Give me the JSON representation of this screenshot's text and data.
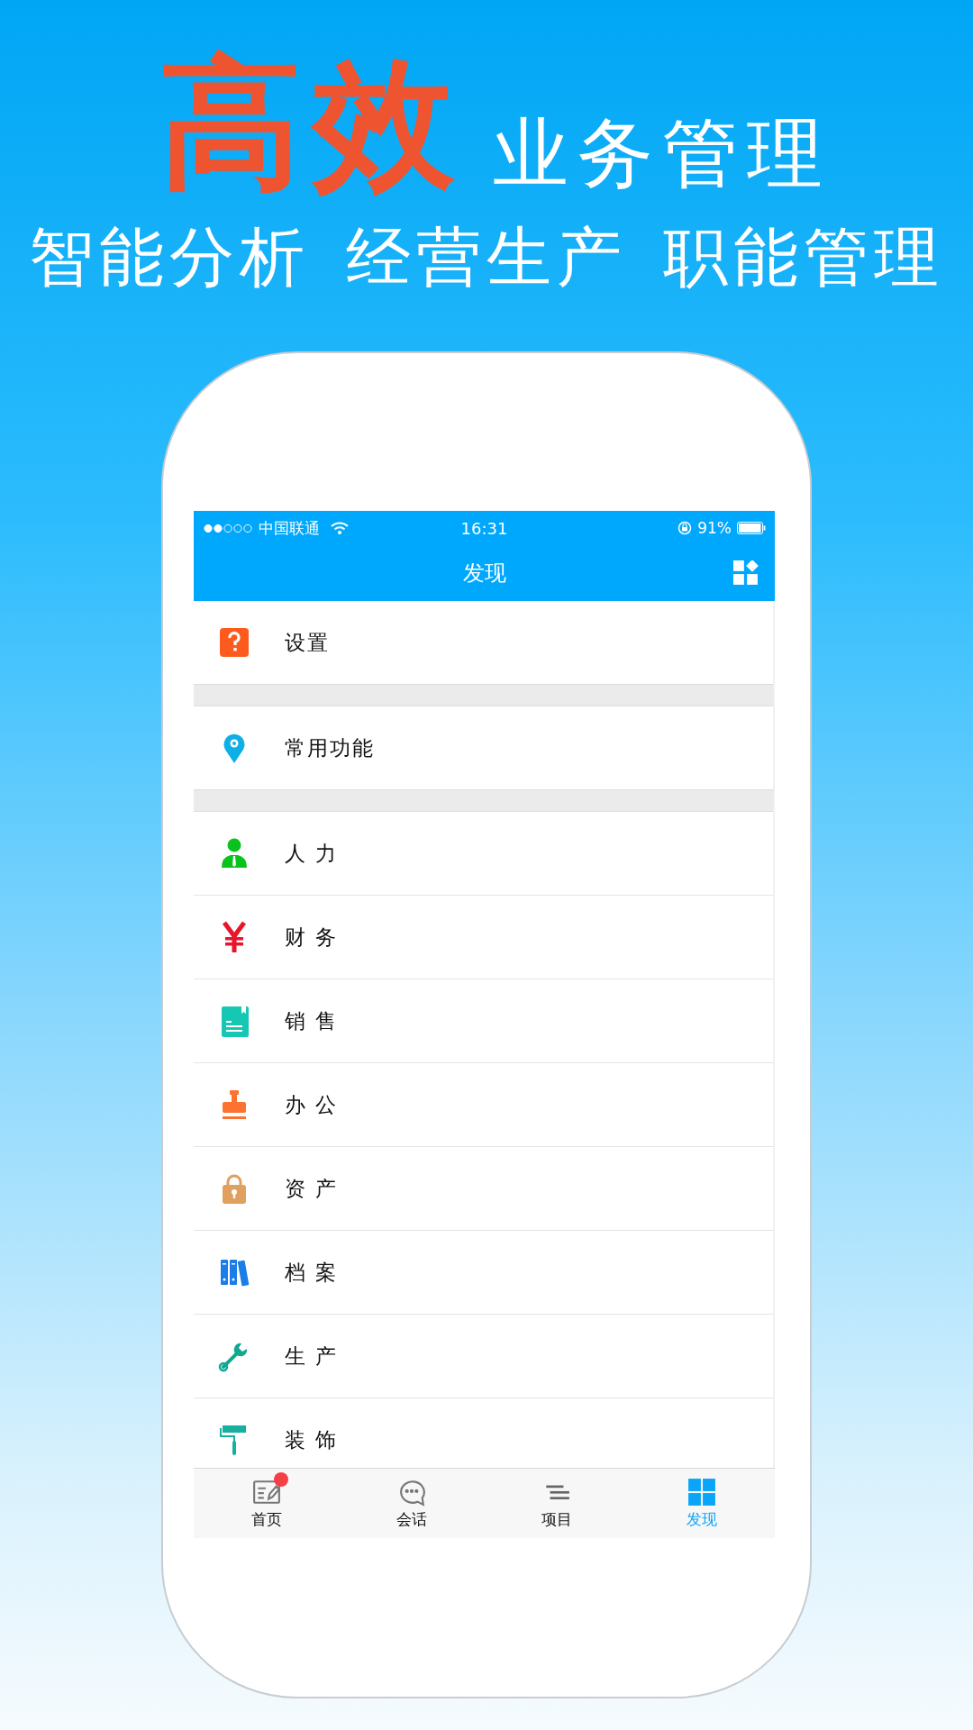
{
  "headline": {
    "emphasis": "高效",
    "rest": "业务管理"
  },
  "slogans": [
    "智能分析",
    "经营生产",
    "职能管理"
  ],
  "status_bar": {
    "carrier": "中国联通",
    "time": "16:31",
    "battery": "91%"
  },
  "nav_bar": {
    "title": "发现"
  },
  "sections": [
    [
      {
        "label": "设置"
      }
    ],
    [
      {
        "label": "常用功能"
      }
    ],
    [
      {
        "label": "人 力"
      },
      {
        "label": "财 务"
      },
      {
        "label": "销 售"
      },
      {
        "label": "办 公"
      },
      {
        "label": "资 产"
      },
      {
        "label": "档 案"
      },
      {
        "label": "生 产"
      },
      {
        "label": "装 饰"
      }
    ]
  ],
  "tabs": [
    {
      "label": "首页",
      "selected": false,
      "badge": true
    },
    {
      "label": "会话",
      "selected": false,
      "badge": false
    },
    {
      "label": "项目",
      "selected": false,
      "badge": false
    },
    {
      "label": "发现",
      "selected": true,
      "badge": false
    }
  ]
}
